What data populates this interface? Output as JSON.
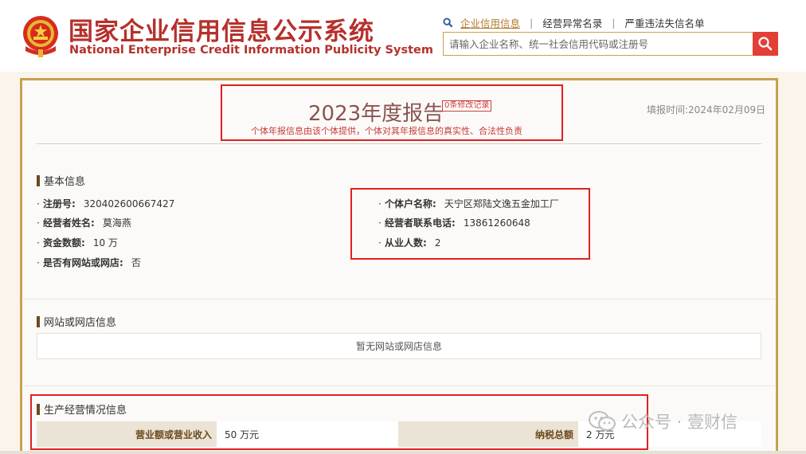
{
  "header": {
    "title_cn": "国家企业信用信息公示系统",
    "title_en": "National Enterprise Credit Information Publicity System",
    "nav": [
      {
        "label": "企业信用信息",
        "active": true
      },
      {
        "label": "经营异常名录",
        "active": false
      },
      {
        "label": "严重违法失信名单",
        "active": false
      }
    ],
    "search": {
      "placeholder": "请输入企业名称、统一社会信用代码或注册号",
      "value": ""
    }
  },
  "report": {
    "title": "2023年度报告",
    "modify_record": "0条修改记录",
    "subtitle": "个体年报信息由该个体提供，个体对其年报信息的真实性、合法性负责",
    "fill_time": "填报时间:2024年02月09日"
  },
  "basic_info": {
    "title": "基本信息",
    "left": [
      {
        "label": "注册号:",
        "value": "320402600667427"
      },
      {
        "label": "经营者姓名:",
        "value": "莫海燕"
      },
      {
        "label": "资金数额:",
        "value": "10 万"
      },
      {
        "label": "是否有网站或网店:",
        "value": "否"
      }
    ],
    "right": [
      {
        "label": "个体户名称:",
        "value": "天宁区郑陆文逸五金加工厂"
      },
      {
        "label": "经营者联系电话:",
        "value": "13861260648"
      },
      {
        "label": "从业人数:",
        "value": "2"
      }
    ]
  },
  "website_info": {
    "title": "网站或网店信息",
    "empty_text": "暂无网站或网店信息"
  },
  "production_info": {
    "title": "生产经营情况信息",
    "revenue_label": "营业额或营业收入",
    "revenue_value": "50 万元",
    "tax_label": "纳税总额",
    "tax_value": "2 万元"
  },
  "watermark": {
    "text": "公众号 · 壹财信"
  },
  "colors": {
    "brand_red": "#b6312c",
    "gold_border": "#c9a050",
    "highlight_red": "#e02020",
    "search_button": "#e23f36"
  }
}
